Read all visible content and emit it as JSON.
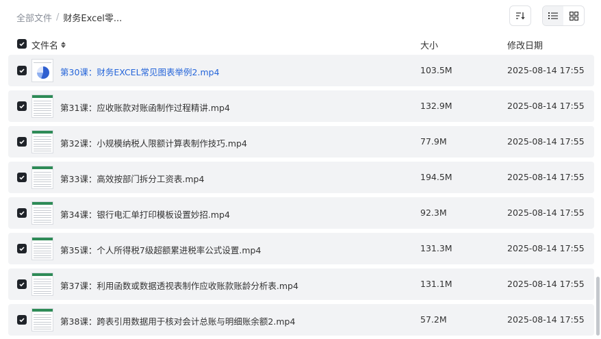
{
  "breadcrumb": {
    "root": "全部文件",
    "separator": "/",
    "current": "财务Excel零..."
  },
  "toolbar": {
    "sort_icon": "sort-icon",
    "view_list_icon": "list-view-icon",
    "view_grid_icon": "grid-view-icon",
    "active_view": "list"
  },
  "table": {
    "columns": {
      "name": "文件名",
      "size": "大小",
      "modified": "修改日期"
    },
    "select_all_checked": true,
    "rows": [
      {
        "name": "第30课：财务EXCEL常见图表举例2.mp4",
        "size": "103.5M",
        "date": "2025-08-14 17:55",
        "checked": true,
        "thumb": "pie-chart"
      },
      {
        "name": "第31课：应收账款对账函制作过程精讲.mp4",
        "size": "132.9M",
        "date": "2025-08-14 17:55",
        "checked": true,
        "thumb": "sheet"
      },
      {
        "name": "第32课：小规模纳税人限额计算表制作技巧.mp4",
        "size": "77.9M",
        "date": "2025-08-14 17:55",
        "checked": true,
        "thumb": "sheet"
      },
      {
        "name": "第33课：高效按部门拆分工资表.mp4",
        "size": "194.5M",
        "date": "2025-08-14 17:55",
        "checked": true,
        "thumb": "sheet"
      },
      {
        "name": "第34课：银行电汇单打印模板设置妙招.mp4",
        "size": "92.3M",
        "date": "2025-08-14 17:55",
        "checked": true,
        "thumb": "sheet"
      },
      {
        "name": "第35课：个人所得税7级超额累进税率公式设置.mp4",
        "size": "131.3M",
        "date": "2025-08-14 17:55",
        "checked": true,
        "thumb": "sheet"
      },
      {
        "name": "第37课：利用函数或数据透视表制作应收账款账龄分析表.mp4",
        "size": "131.1M",
        "date": "2025-08-14 17:55",
        "checked": true,
        "thumb": "sheet"
      },
      {
        "name": "第38课：跨表引用数据用于核对会计总账与明细账余额2.mp4",
        "size": "57.2M",
        "date": "2025-08-14 17:55",
        "checked": true,
        "thumb": "sheet"
      }
    ]
  },
  "colors": {
    "row_bg": "#f2f3f5",
    "link": "#2565d9",
    "checkbox": "#1f2329"
  }
}
